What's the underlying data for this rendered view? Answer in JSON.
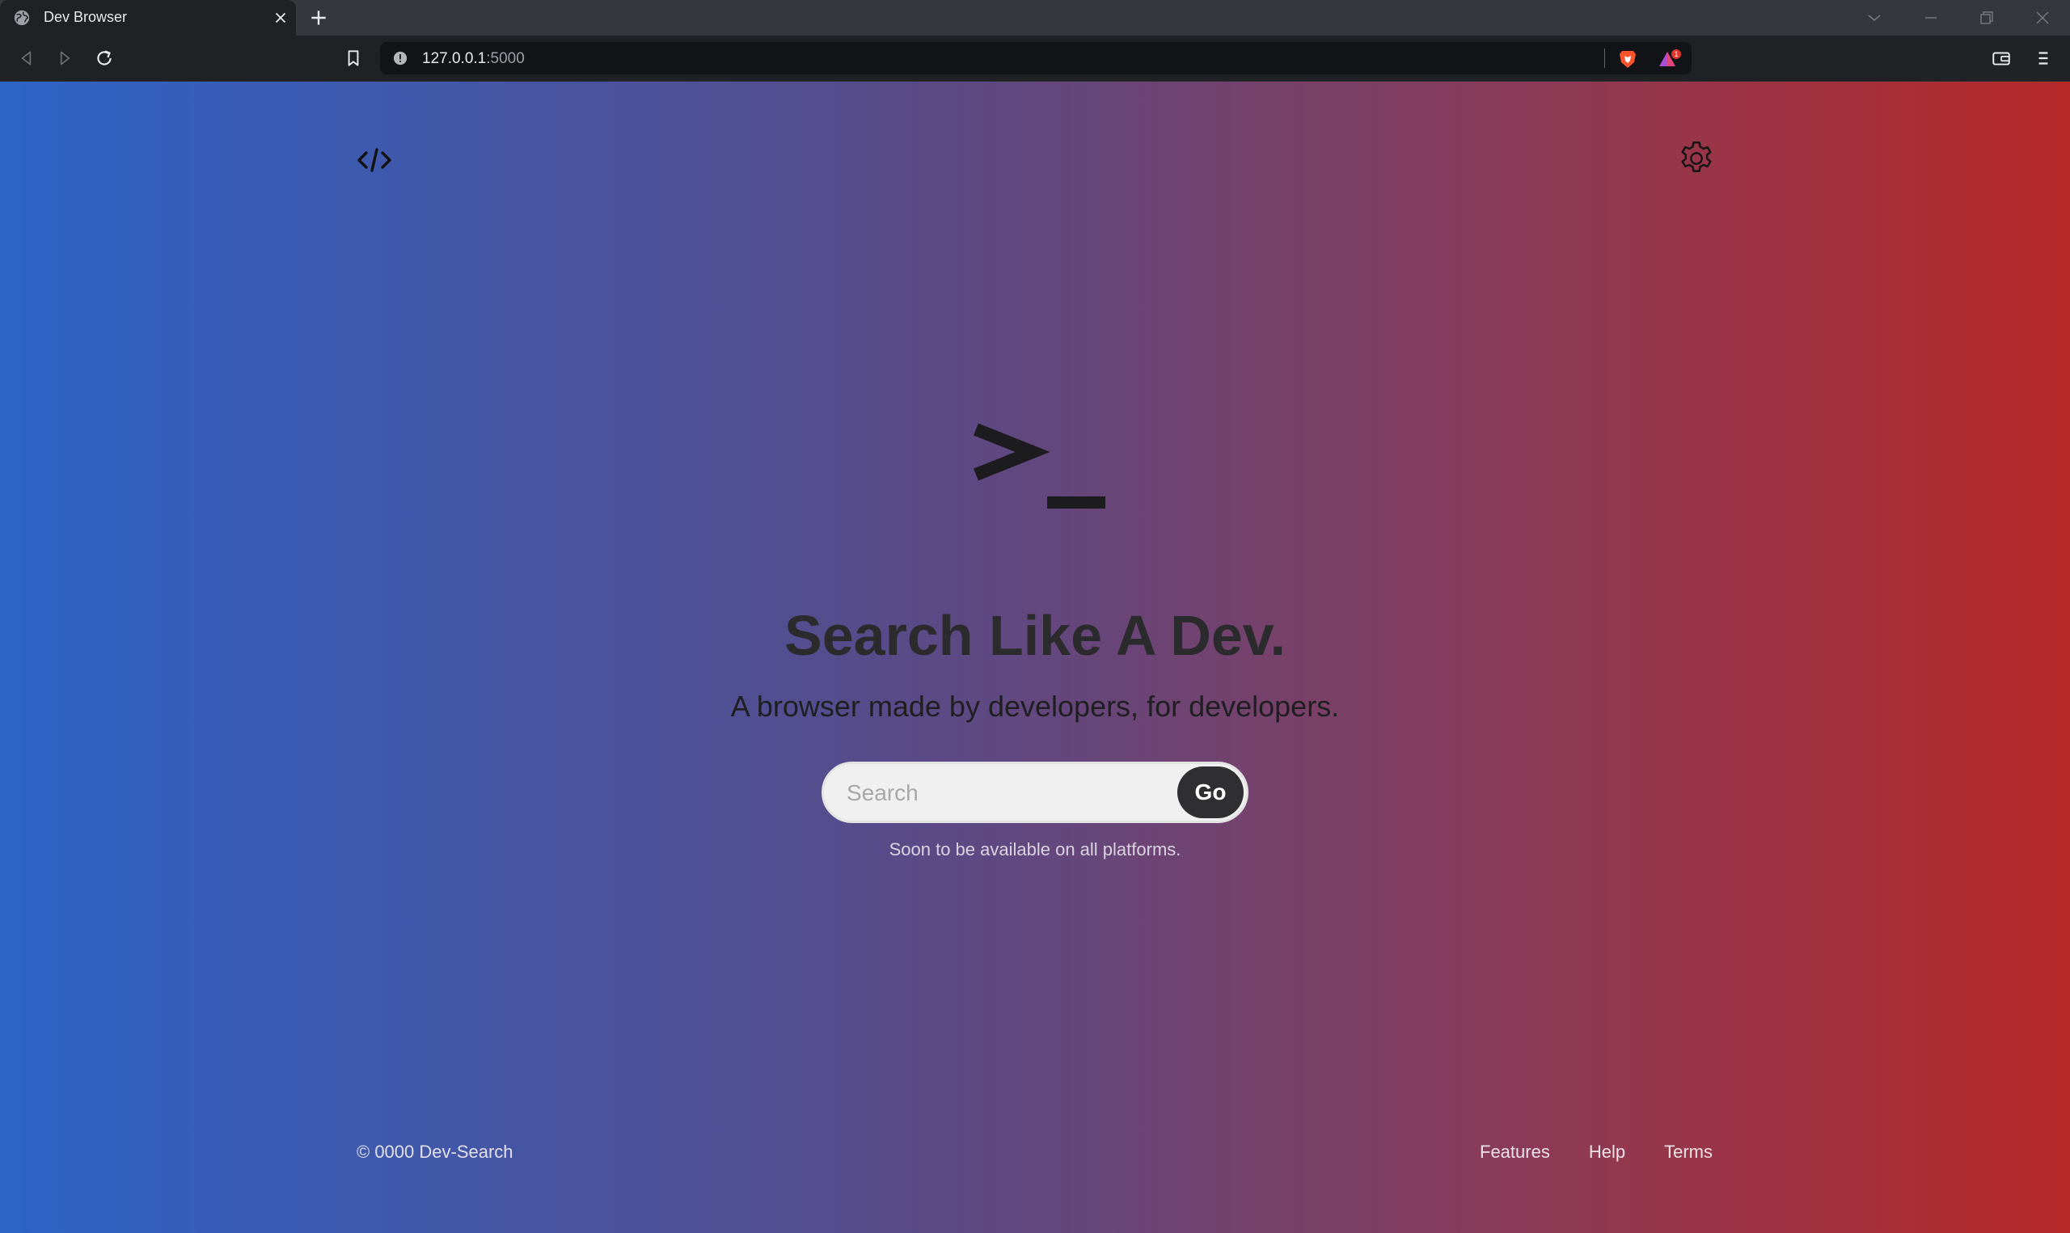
{
  "browser": {
    "tab_title": "Dev Browser",
    "url_host": "127.0.0.1",
    "url_port": ":5000",
    "rewards_badge": "1"
  },
  "icons": {
    "tab_favicon": "globe-icon",
    "tab_close": "close-icon",
    "new_tab": "plus-icon",
    "back": "back-arrow-icon",
    "forward": "forward-arrow-icon",
    "reload": "reload-icon",
    "bookmark": "bookmark-icon",
    "site_info": "info-icon",
    "brave_shields": "brave-lion-icon",
    "brave_rewards": "rewards-triangle-icon",
    "wallet": "wallet-icon",
    "menu": "hamburger-menu-icon",
    "logo": "code-brackets-icon",
    "settings": "gear-icon",
    "hero": "terminal-prompt-icon"
  },
  "colors": {
    "gradient_left": "#2c63c7",
    "gradient_mid": "#5a4a86",
    "gradient_right": "#b62828",
    "go_button": "#2f2f31"
  },
  "hero": {
    "headline": "Search Like A Dev.",
    "tagline": "A browser made by developers, for developers."
  },
  "search": {
    "placeholder": "Search",
    "value": "",
    "button_label": "Go",
    "note": "Soon to be available on all platforms."
  },
  "footer": {
    "copyright": "© 0000 Dev-Search",
    "links": [
      "Features",
      "Help",
      "Terms"
    ]
  }
}
